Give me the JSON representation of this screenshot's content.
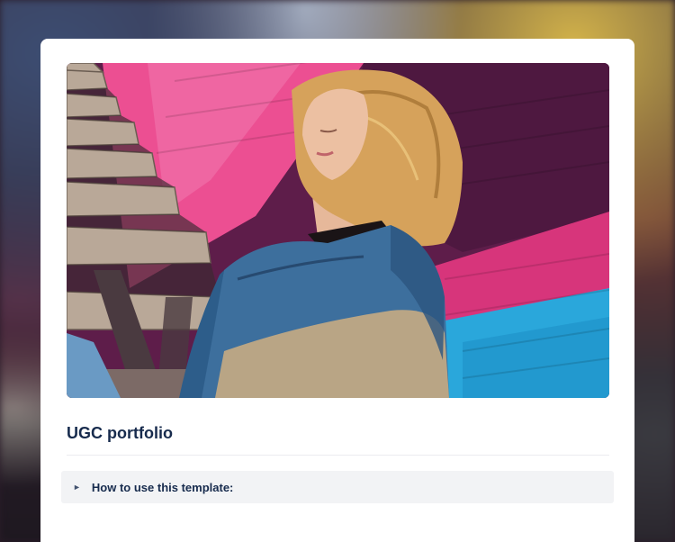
{
  "page": {
    "title": "UGC portfolio"
  },
  "hero": {
    "alt": "Woman in denim jacket leaning against a pink, purple and blue painted brick wall",
    "icon": "hero-photo"
  },
  "expand": {
    "icon": "triangle-right-icon",
    "glyph": "►",
    "label": "How to use this template:"
  },
  "colors": {
    "title": "#172b4d",
    "expand_bg": "#f2f3f5",
    "wall_pink": "#d9357a",
    "wall_purple": "#5e1d4a",
    "wall_blue": "#1e9fd4"
  }
}
